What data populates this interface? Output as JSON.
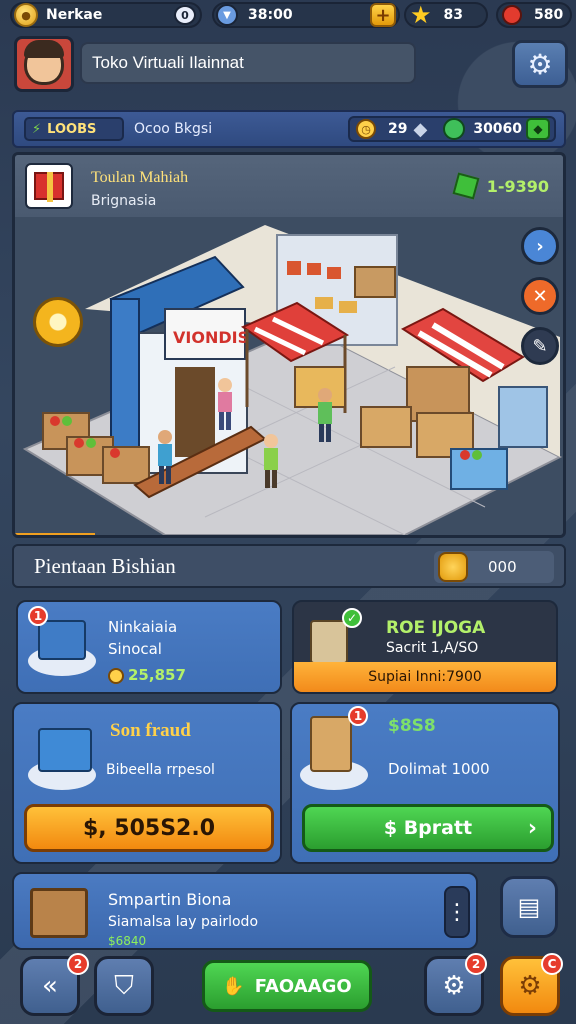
{
  "status_bar": {
    "player_name": "Nerkae",
    "currency_1": "38:00",
    "stars": "83",
    "gems": "580"
  },
  "header": {
    "title": "Toko Virtuali Ilainnat"
  },
  "resource_bar": {
    "left_badge": "LOOBS",
    "label": "Ocoo Bkgsi",
    "count": "29",
    "money": "30060"
  },
  "shop": {
    "title": "Toulan Mahiah",
    "subtitle": "Brignasia",
    "price": "1-9390",
    "store_sign": "VIONDIS"
  },
  "section": {
    "title": "Pientaan Bishian",
    "value": "000"
  },
  "cards": {
    "card1": {
      "badge": "1",
      "name": "Ninkaiaia",
      "sub": "Sinocal",
      "value": "25,857"
    },
    "card2": {
      "badge": "",
      "title": "ROE IJOGA",
      "sub": "Sacrit 1,A/SO",
      "footer": "Supiai Inni:7900"
    },
    "card3": {
      "title": "Son fraud",
      "sub": "Bibeella rrpesol",
      "button": "$, 505S2.0"
    },
    "card4": {
      "badge": "1",
      "title": "$8S8",
      "sub": "Dolimat 1000",
      "button": "$ Bpratt"
    }
  },
  "info_bar": {
    "title": "Smpartin Biona",
    "sub": "Siamalsa lay pairlodo",
    "value": "$6840"
  },
  "bottom_nav": {
    "back_badge": "2",
    "main_button": "FAOAAGO",
    "alert_badge": "2",
    "settings_badge": "C"
  },
  "colors": {
    "accent_blue": "#3f6fb6",
    "accent_orange": "#f2890f",
    "accent_green": "#2b9e2f",
    "gold": "#ffe27a"
  }
}
